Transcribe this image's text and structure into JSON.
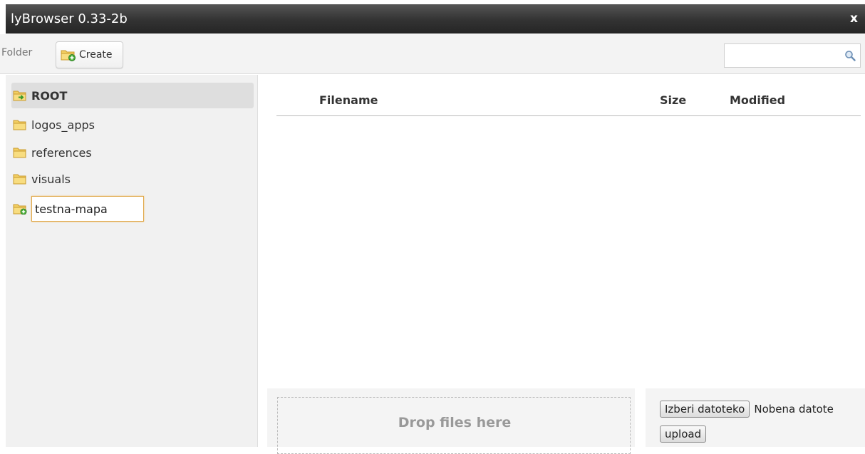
{
  "window": {
    "title": "lyBrowser 0.33-2b",
    "close_label": "x"
  },
  "toolbar": {
    "folder_label": "Folder",
    "create_label": "Create",
    "search": {
      "value": "",
      "placeholder": ""
    }
  },
  "tree": {
    "root_label": "ROOT",
    "items": [
      {
        "label": "logos_apps",
        "icon": "folder-icon"
      },
      {
        "label": "references",
        "icon": "folder-icon"
      },
      {
        "label": "visuals",
        "icon": "folder-icon"
      }
    ],
    "new_folder": {
      "value": "testna-mapa",
      "icon": "folder-add-icon"
    }
  },
  "file_list": {
    "columns": [
      "Filename",
      "Size",
      "Modified"
    ],
    "rows": []
  },
  "upload": {
    "drop_text": "Drop files here",
    "choose_button": "Izberi datoteko",
    "no_file_text": "Nobena datote",
    "upload_button": "upload"
  },
  "colors": {
    "titlebar": "#333333",
    "sidebar_bg": "#f1f1f1",
    "selected_bg": "#dedede",
    "input_focus_border": "#e0a84a"
  }
}
